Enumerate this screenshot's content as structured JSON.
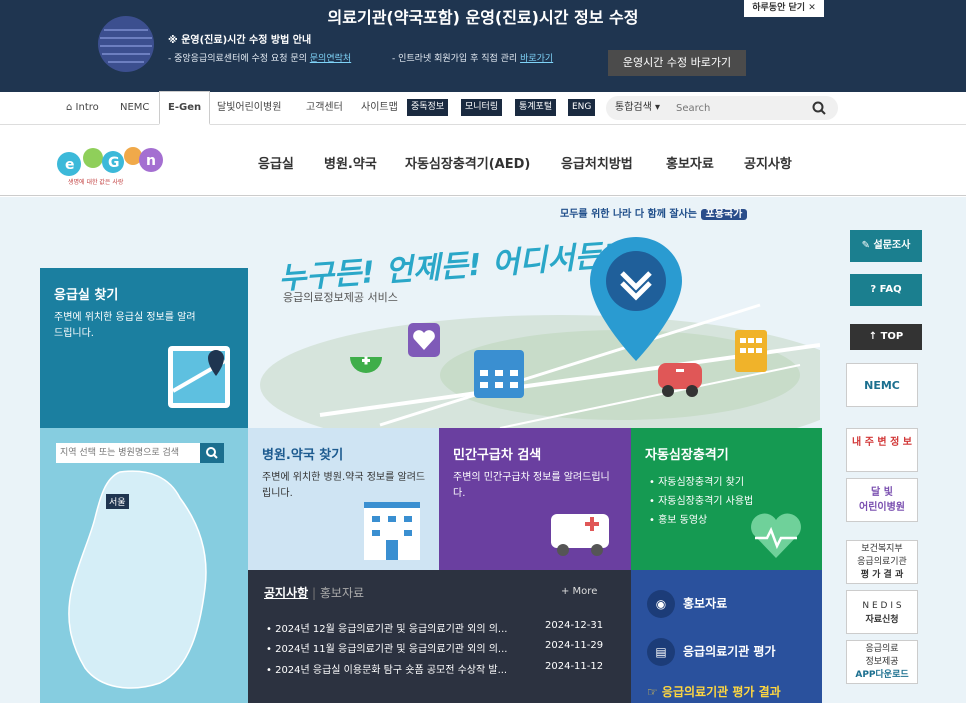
{
  "banner": {
    "title": "의료기관(약국포함) 운영(진료)시간 정보 수정",
    "guide": "※ 운영(진료)시간 수정 방법 안내",
    "line1_prefix": "- 중앙응급의료센터에 수정 요청 문의 ",
    "line1_link": "문의연락처",
    "line2_prefix": "- 인트라넷 회원가입 후 직접 관리 ",
    "line2_link": "바로가기",
    "cta": "운영시간 수정 바로가기",
    "close": "하루동안 닫기 ✕"
  },
  "util": {
    "intro": "Intro",
    "nemc": "NEMC",
    "egen": "E-Gen",
    "moon": "달빛어린이병원",
    "cs": "고객센터",
    "sitemap": "사이트맵",
    "btn1": "중독정보",
    "btn2": "모니터링",
    "btn3": "통계포털",
    "btn4": "ENG",
    "search_select": "통합검색 ▾",
    "search_placeholder": "Search"
  },
  "logo": {
    "sub": "생명에 대한 값은 사랑"
  },
  "nav": [
    "응급실",
    "병원.약국",
    "자동심장충격기(AED)",
    "응급처치방법",
    "홍보자료",
    "공지사항"
  ],
  "slogan": {
    "text": "모두를 위한 나라 다 함께 잘사는 ",
    "tag": "포용국가"
  },
  "hero": {
    "title": "누구든! 언제든! 어디서든!",
    "sub": "응급의료정보제공 서비스"
  },
  "er": {
    "title": "응급실 찾기",
    "desc": "주변에 위치한 응급실 정보를 알려드립니다."
  },
  "map": {
    "placeholder": "지역 선택 또는 병원명으로 검색",
    "city": "서울"
  },
  "hosp": {
    "title": "병원.약국 찾기",
    "desc": "주변에 위치한 병원.약국 정보를 알려드립니다."
  },
  "priv": {
    "title": "민간구급차 검색",
    "desc": "주변의 민간구급차 정보를 알려드립니다."
  },
  "aed": {
    "title": "자동심장충격기",
    "items": [
      "• 자동심장충격기 찾기",
      "• 자동심장충격기 사용법",
      "• 홍보 동영상"
    ]
  },
  "notice": {
    "tab_active": "공지사항",
    "tab_other": "홍보자료",
    "more": "+ More",
    "rows": [
      {
        "title": "• 2024년 12월 응급의료기관 및 응급의료기관 외의 의...",
        "date": "2024-12-31"
      },
      {
        "title": "• 2024년 11월 응급의료기관 및 응급의료기관 외의 의...",
        "date": "2024-11-29"
      },
      {
        "title": "• 2024년 응급실 이용문화 탐구 숏폼 공모전 수상작 발...",
        "date": "2024-11-12"
      }
    ]
  },
  "promo": {
    "item1": "홍보자료",
    "item2": "응급의료기관 평가",
    "eval": "☞ 응급의료기관 평가 결과"
  },
  "rail": {
    "survey": "✎ 설문조사",
    "faq": "? FAQ",
    "top": "↑ TOP",
    "nemc": "NEMC",
    "local": "내 주 변 정 보",
    "moon1": "달 빛",
    "moon2": "어린이병원",
    "mohw1": "보건복지부",
    "mohw2": "응급의료기관",
    "mohw3": "평 가 결 과",
    "nedis1": "N E D I S",
    "nedis2": "자료신청",
    "app1": "응급의료",
    "app2": "정보제공",
    "app3": "APP다운로드"
  },
  "colors": {
    "banner": "#1f3550",
    "er": "#1b7fa0",
    "priv": "#6a3fa0",
    "aed": "#159a52",
    "promo": "#2a519d"
  }
}
